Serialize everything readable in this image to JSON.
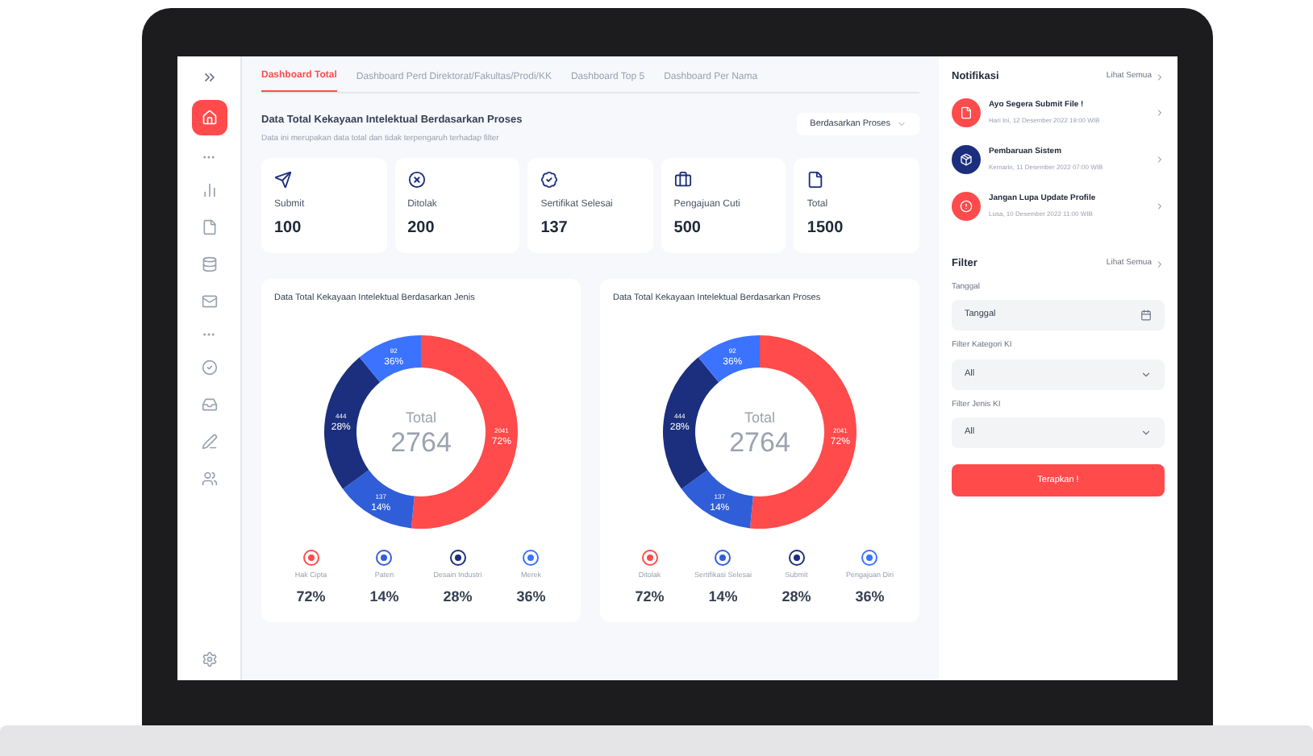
{
  "sidebar": {
    "items": [
      {
        "kind": "home",
        "selected": true
      },
      {
        "kind": "dots"
      },
      {
        "kind": "chart",
        "selected": false
      },
      {
        "kind": "file",
        "selected": false
      },
      {
        "kind": "database",
        "selected": false
      },
      {
        "kind": "mail",
        "selected": false
      },
      {
        "kind": "dots"
      },
      {
        "kind": "check",
        "selected": false
      },
      {
        "kind": "inbox",
        "selected": false
      },
      {
        "kind": "edit",
        "selected": false
      },
      {
        "kind": "users",
        "selected": false
      }
    ]
  },
  "tabs": [
    {
      "label": "Dashboard Total",
      "selected": true
    },
    {
      "label": "Dashboard Perd Direktorat/Fakultas/Prodi/KK",
      "selected": false
    },
    {
      "label": "Dashboard Top 5",
      "selected": false
    },
    {
      "label": "Dashboard Per Nama",
      "selected": false
    }
  ],
  "header": {
    "title": "Data Total Kekayaan Intelektual Berdasarkan Proses",
    "subtitle": "Data ini merupakan data total dan tidak terpengaruh terhadap filter",
    "dropdown": "Berdasarkan Proses"
  },
  "stats": [
    {
      "kind": "send",
      "label": "Submit",
      "value": "100"
    },
    {
      "kind": "rejected",
      "label": "Ditolak",
      "value": "200"
    },
    {
      "kind": "certificate",
      "label": "Sertifikat Selesai",
      "value": "137"
    },
    {
      "kind": "briefcase",
      "label": "Pengajuan Cuti",
      "value": "500"
    },
    {
      "kind": "file",
      "label": "Total",
      "value": "1500"
    }
  ],
  "charts": [
    {
      "title": "Data Total Kekayaan Intelektual Berdasarkan Jenis",
      "center_label": "Total",
      "center_value": "2764",
      "slices": [
        {
          "count": "2041",
          "percent": "72%",
          "color": "#ff4b4b"
        },
        {
          "count": "137",
          "percent": "14%",
          "color": "#2f5ed8"
        },
        {
          "count": "444",
          "percent": "28%",
          "color": "#1b2f7e"
        },
        {
          "count": "92",
          "percent": "36%",
          "color": "#3b73ff"
        }
      ],
      "legend": [
        {
          "label": "Hak Cipta",
          "percent": "72%",
          "color": "#ff4b4b"
        },
        {
          "label": "Paten",
          "percent": "14%",
          "color": "#2f5ed8"
        },
        {
          "label": "Desain Industri",
          "percent": "28%",
          "color": "#1b2f7e"
        },
        {
          "label": "Merek",
          "percent": "36%",
          "color": "#3b73ff"
        }
      ]
    },
    {
      "title": "Data Total Kekayaan Intelektual Berdasarkan Proses",
      "center_label": "Total",
      "center_value": "2764",
      "slices": [
        {
          "count": "2041",
          "percent": "72%",
          "color": "#ff4b4b"
        },
        {
          "count": "137",
          "percent": "14%",
          "color": "#2f5ed8"
        },
        {
          "count": "444",
          "percent": "28%",
          "color": "#1b2f7e"
        },
        {
          "count": "92",
          "percent": "36%",
          "color": "#3b73ff"
        }
      ],
      "legend": [
        {
          "label": "Ditolak",
          "percent": "72%",
          "color": "#ff4b4b"
        },
        {
          "label": "Sertifikasi Selesai",
          "percent": "14%",
          "color": "#2f5ed8"
        },
        {
          "label": "Submit",
          "percent": "28%",
          "color": "#1b2f7e"
        },
        {
          "label": "Pengajuan Diri",
          "percent": "36%",
          "color": "#3b73ff"
        }
      ]
    }
  ],
  "notifications": {
    "title": "Notifikasi",
    "link": "Lihat Semua",
    "items": [
      {
        "kind": "file",
        "title": "Ayo Segera Submit File !",
        "time": "Hari Ini, 12 Desember 2022 19:00 WIB",
        "color": "#ff4b4b"
      },
      {
        "kind": "box",
        "title": "Pembaruan Sistem",
        "time": "Kemarin, 11 Desember 2022 07:00 WIB",
        "color": "#1b2f7e"
      },
      {
        "kind": "alert",
        "title": "Jangan Lupa Update Profile",
        "time": "Lusa, 10 Desember 2022 11:00 WIB",
        "color": "#ff4b4b"
      }
    ]
  },
  "filter": {
    "title": "Filter",
    "link": "Lihat Semua",
    "fields": [
      {
        "kind": "date",
        "label": "Tanggal",
        "value": "Tanggal"
      },
      {
        "kind": "select",
        "label": "Filter Kategori KI",
        "value": "All"
      },
      {
        "kind": "select",
        "label": "Filter Jenis KI",
        "value": "All"
      }
    ],
    "button": "Terapkan !"
  }
}
